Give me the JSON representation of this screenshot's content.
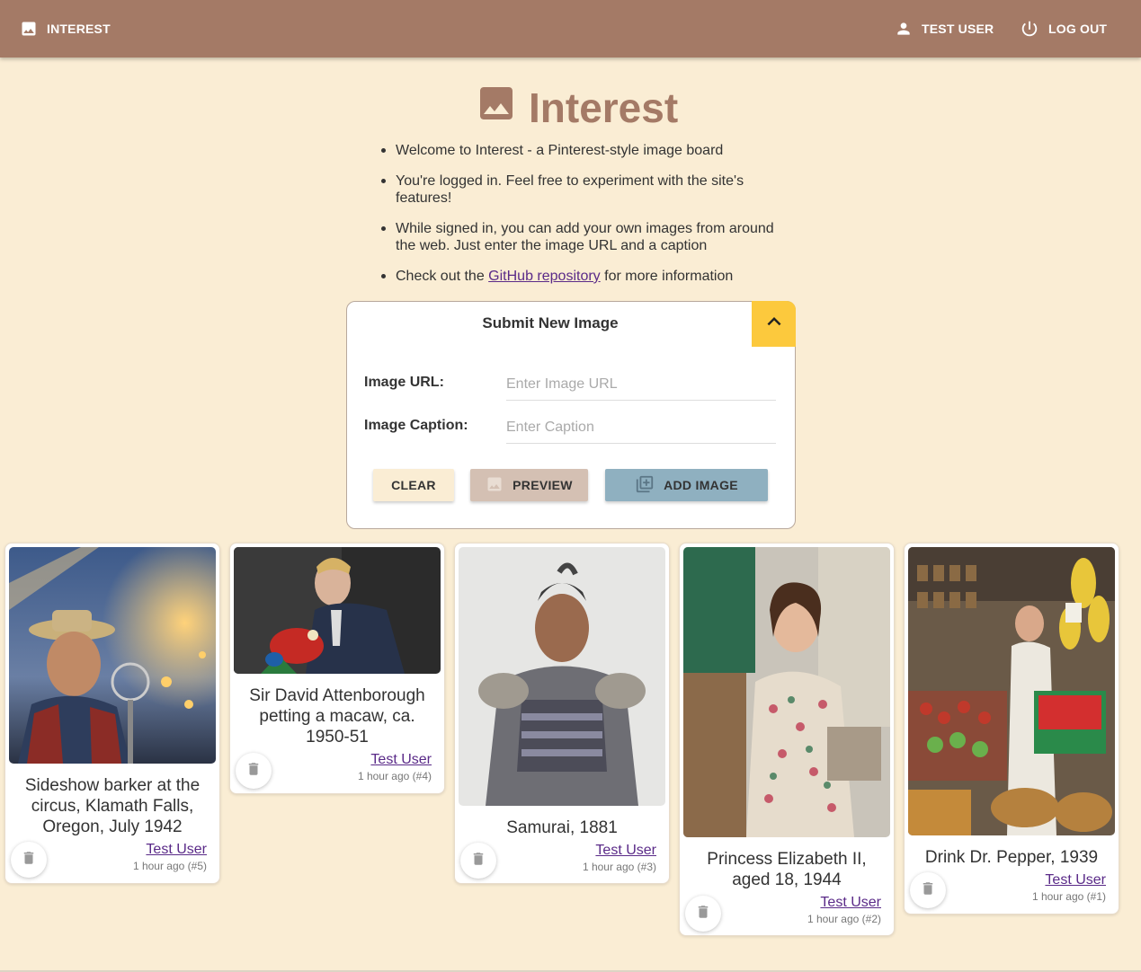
{
  "nav": {
    "brand": "INTEREST",
    "user": "TEST USER",
    "logout": "LOG OUT"
  },
  "hero": {
    "title": "Interest"
  },
  "intro": {
    "line1": "Welcome to Interest - a Pinterest-style image board",
    "line2": "You're logged in. Feel free to experiment with the site's features!",
    "line3": "While signed in, you can add your own images from around the web. Just enter the image URL and a caption",
    "line4_pre": "Check out the ",
    "line4_link": "GitHub repository",
    "line4_post": " for more information"
  },
  "submit": {
    "title": "Submit New Image",
    "url_label": "Image URL:",
    "url_placeholder": "Enter Image URL",
    "url_value": "",
    "caption_label": "Image Caption:",
    "caption_placeholder": "Enter Caption",
    "caption_value": "",
    "clear": "CLEAR",
    "preview": "PREVIEW",
    "add": "ADD IMAGE"
  },
  "colors": {
    "topbar": "#a47a66",
    "background": "#faedd4",
    "accent_yellow": "#fcc93d",
    "link": "#5a2a88",
    "add_button": "#8fb0c0",
    "preview_button": "#d4c0b3"
  },
  "cards": [
    {
      "caption": "Sideshow barker at the circus, Klamath Falls, Oregon, July 1942",
      "author": "Test User",
      "meta": "1 hour ago (#5)"
    },
    {
      "caption": "Sir David Attenborough petting a macaw, ca. 1950-51",
      "author": "Test User",
      "meta": "1 hour ago (#4)"
    },
    {
      "caption": "Samurai, 1881",
      "author": "Test User",
      "meta": "1 hour ago (#3)"
    },
    {
      "caption": "Princess Elizabeth II, aged 18, 1944",
      "author": "Test User",
      "meta": "1 hour ago (#2)"
    },
    {
      "caption": "Drink Dr. Pepper, 1939",
      "author": "Test User",
      "meta": "1 hour ago (#1)"
    }
  ]
}
